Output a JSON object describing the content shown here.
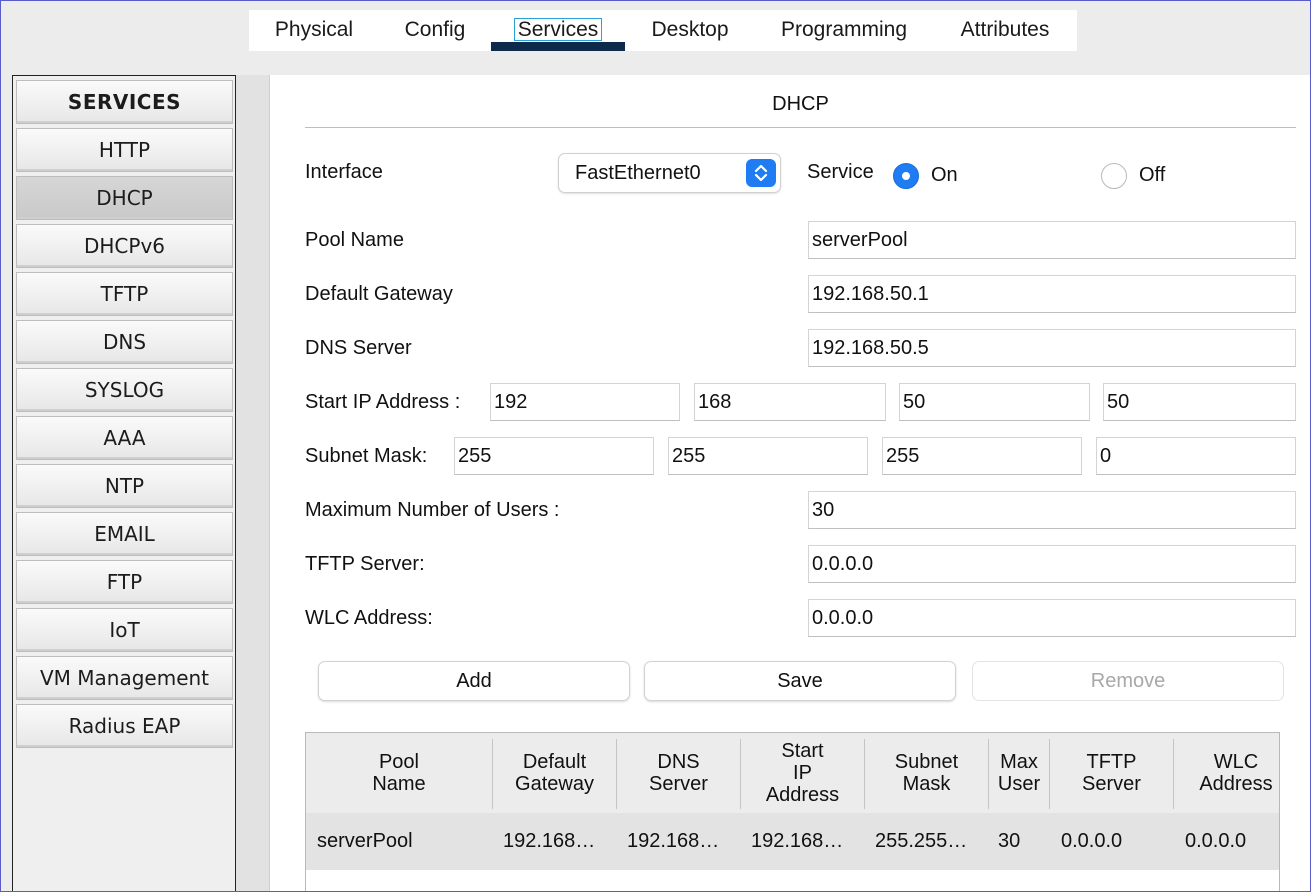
{
  "tabs": [
    {
      "label": "Physical"
    },
    {
      "label": "Config"
    },
    {
      "label": "Services"
    },
    {
      "label": "Desktop"
    },
    {
      "label": "Programming"
    },
    {
      "label": "Attributes"
    }
  ],
  "active_tab": "Services",
  "sidebar": {
    "header": "SERVICES",
    "items": [
      {
        "label": "HTTP"
      },
      {
        "label": "DHCP"
      },
      {
        "label": "DHCPv6"
      },
      {
        "label": "TFTP"
      },
      {
        "label": "DNS"
      },
      {
        "label": "SYSLOG"
      },
      {
        "label": "AAA"
      },
      {
        "label": "NTP"
      },
      {
        "label": "EMAIL"
      },
      {
        "label": "FTP"
      },
      {
        "label": "IoT"
      },
      {
        "label": "VM Management"
      },
      {
        "label": "Radius EAP"
      }
    ],
    "selected": "DHCP"
  },
  "panel": {
    "title": "DHCP",
    "interface_label": "Interface",
    "interface_value": "FastEthernet0",
    "service_label": "Service",
    "service_on_label": "On",
    "service_off_label": "Off",
    "service_state": "On",
    "pool_name_label": "Pool Name",
    "pool_name_value": "serverPool",
    "default_gateway_label": "Default Gateway",
    "default_gateway_value": "192.168.50.1",
    "dns_server_label": "DNS Server",
    "dns_server_value": "192.168.50.5",
    "start_ip_label": "Start IP Address :",
    "start_ip_octets": [
      "192",
      "168",
      "50",
      "50"
    ],
    "subnet_mask_label": "Subnet Mask:",
    "subnet_mask_octets": [
      "255",
      "255",
      "255",
      "0"
    ],
    "max_users_label": "Maximum Number of Users :",
    "max_users_value": "30",
    "tftp_server_label": "TFTP Server:",
    "tftp_server_value": "0.0.0.0",
    "wlc_address_label": "WLC Address:",
    "wlc_address_value": "0.0.0.0",
    "buttons": {
      "add": "Add",
      "save": "Save",
      "remove": "Remove"
    }
  },
  "table": {
    "columns": [
      "Pool\nName",
      "Default\nGateway",
      "DNS\nServer",
      "Start\nIP\nAddress",
      "Subnet\nMask",
      "Max\nUser",
      "TFTP\nServer",
      "WLC\nAddress"
    ],
    "rows": [
      [
        "serverPool",
        "192.168…",
        "192.168…",
        "192.168…",
        "255.255…",
        "30",
        "0.0.0.0",
        "0.0.0.0"
      ]
    ]
  },
  "colors": {
    "accent": "#1f7cf2",
    "tab_underline": "#0e2a4a",
    "tab_focus": "#2aa2d6"
  }
}
